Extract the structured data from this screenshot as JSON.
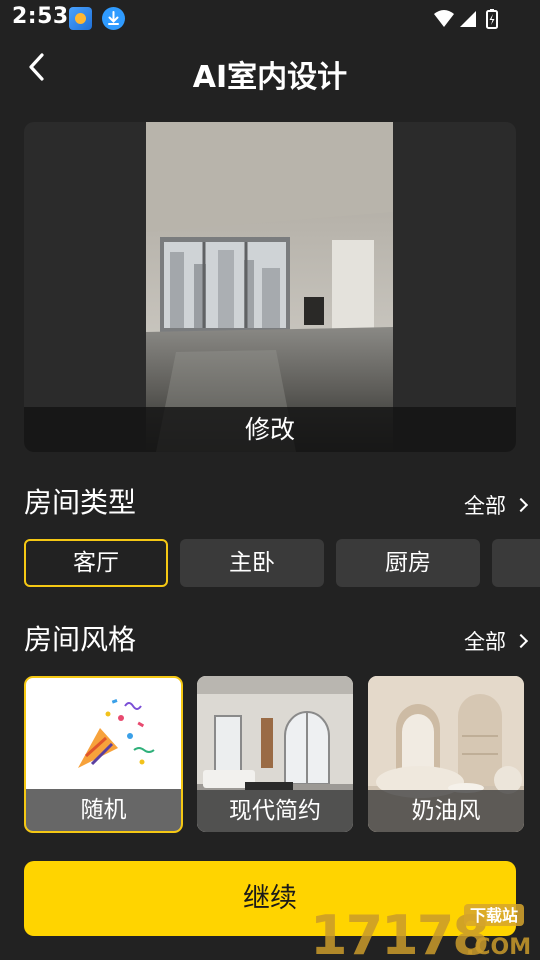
{
  "status_bar": {
    "time": "2:53"
  },
  "header": {
    "title": "AI室内设计"
  },
  "preview": {
    "edit_label": "修改"
  },
  "room_type": {
    "title": "房间类型",
    "all_label": "全部",
    "chips": [
      {
        "label": "客厅",
        "selected": true
      },
      {
        "label": "主卧",
        "selected": false
      },
      {
        "label": "厨房",
        "selected": false
      }
    ]
  },
  "room_style": {
    "title": "房间风格",
    "all_label": "全部",
    "cards": [
      {
        "label": "随机",
        "selected": true
      },
      {
        "label": "现代简约",
        "selected": false
      },
      {
        "label": "奶油风",
        "selected": false
      }
    ]
  },
  "continue_label": "继续",
  "watermark": {
    "number": "17178",
    "site_cn": "下载站",
    "domain": ".COM"
  },
  "colors": {
    "accent": "#ffd400",
    "selected_border": "#f5c814",
    "background": "#222222"
  }
}
